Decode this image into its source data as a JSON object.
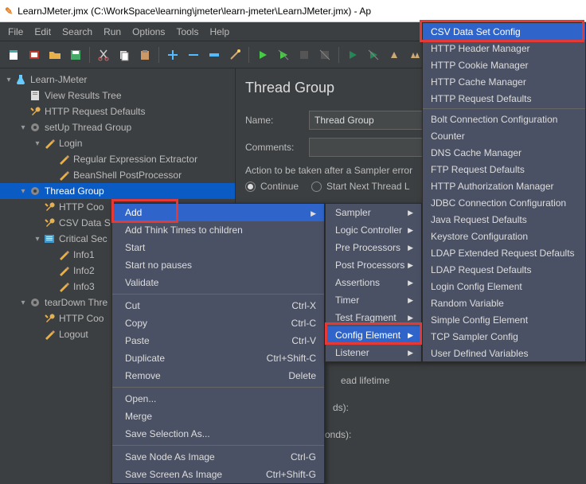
{
  "title": "LearnJMeter.jmx (C:\\WorkSpace\\learning\\jmeter\\learn-jmeter\\LearnJMeter.jmx) - Ap",
  "menubar": [
    "File",
    "Edit",
    "Search",
    "Run",
    "Options",
    "Tools",
    "Help"
  ],
  "tree": [
    {
      "indent": 0,
      "tw": "▾",
      "icon": "beaker",
      "label": "Learn-JMeter"
    },
    {
      "indent": 1,
      "tw": "",
      "icon": "doc",
      "label": "View Results Tree"
    },
    {
      "indent": 1,
      "tw": "",
      "icon": "wrench",
      "label": "HTTP Request Defaults"
    },
    {
      "indent": 1,
      "tw": "▾",
      "icon": "gear",
      "label": "setUp Thread Group"
    },
    {
      "indent": 2,
      "tw": "▾",
      "icon": "pen",
      "label": "Login"
    },
    {
      "indent": 3,
      "tw": "",
      "icon": "pen",
      "label": "Regular Expression Extractor"
    },
    {
      "indent": 3,
      "tw": "",
      "icon": "pen",
      "label": "BeanShell PostProcessor"
    },
    {
      "indent": 1,
      "tw": "▾",
      "icon": "gear",
      "label": "Thread Group",
      "sel": true
    },
    {
      "indent": 2,
      "tw": "",
      "icon": "wrench",
      "label": "HTTP Coo"
    },
    {
      "indent": 2,
      "tw": "",
      "icon": "wrench",
      "label": "CSV Data S"
    },
    {
      "indent": 2,
      "tw": "▾",
      "icon": "list",
      "label": "Critical Sec"
    },
    {
      "indent": 3,
      "tw": "",
      "icon": "pen",
      "label": "Info1"
    },
    {
      "indent": 3,
      "tw": "",
      "icon": "pen",
      "label": "Info2"
    },
    {
      "indent": 3,
      "tw": "",
      "icon": "pen",
      "label": "Info3"
    },
    {
      "indent": 1,
      "tw": "▾",
      "icon": "gear",
      "label": "tearDown Thre"
    },
    {
      "indent": 2,
      "tw": "",
      "icon": "wrench",
      "label": "HTTP Coo"
    },
    {
      "indent": 2,
      "tw": "",
      "icon": "pen",
      "label": "Logout"
    }
  ],
  "main": {
    "heading": "Thread Group",
    "name_label": "Name:",
    "name_value": "Thread Group",
    "comments_label": "Comments:",
    "comments_value": "",
    "action_label": "Action to be taken after a Sampler error",
    "continue": "Continue",
    "startnext": "Start Next Thread L",
    "leftover1": "ead lifetime",
    "leftover2": "ds):",
    "leftover3": "conds):"
  },
  "ctx": {
    "items": [
      {
        "label": "Add",
        "sub": true,
        "sel": true
      },
      {
        "label": "Add Think Times to children"
      },
      {
        "label": "Start"
      },
      {
        "label": "Start no pauses"
      },
      {
        "label": "Validate"
      },
      {
        "div": true
      },
      {
        "label": "Cut",
        "sc": "Ctrl-X"
      },
      {
        "label": "Copy",
        "sc": "Ctrl-C"
      },
      {
        "label": "Paste",
        "sc": "Ctrl-V"
      },
      {
        "label": "Duplicate",
        "sc": "Ctrl+Shift-C"
      },
      {
        "label": "Remove",
        "sc": "Delete"
      },
      {
        "div": true
      },
      {
        "label": "Open..."
      },
      {
        "label": "Merge"
      },
      {
        "label": "Save Selection As..."
      },
      {
        "div": true
      },
      {
        "label": "Save Node As Image",
        "sc": "Ctrl-G"
      },
      {
        "label": "Save Screen As Image",
        "sc": "Ctrl+Shift-G"
      }
    ]
  },
  "submenu": {
    "items": [
      {
        "label": "Sampler"
      },
      {
        "label": "Logic Controller"
      },
      {
        "label": "Pre Processors"
      },
      {
        "label": "Post Processors"
      },
      {
        "label": "Assertions"
      },
      {
        "label": "Timer"
      },
      {
        "label": "Test Fragment"
      },
      {
        "label": "Config Element",
        "sel": true
      },
      {
        "label": "Listener"
      }
    ]
  },
  "cfgmenu": {
    "items": [
      {
        "label": "CSV Data Set Config",
        "sel": true
      },
      {
        "label": "HTTP Header Manager"
      },
      {
        "label": "HTTP Cookie Manager"
      },
      {
        "label": "HTTP Cache Manager"
      },
      {
        "label": "HTTP Request Defaults"
      },
      {
        "div": true
      },
      {
        "label": "Bolt Connection Configuration"
      },
      {
        "label": "Counter"
      },
      {
        "label": "DNS Cache Manager"
      },
      {
        "label": "FTP Request Defaults"
      },
      {
        "label": "HTTP Authorization Manager"
      },
      {
        "label": "JDBC Connection Configuration"
      },
      {
        "label": "Java Request Defaults"
      },
      {
        "label": "Keystore Configuration"
      },
      {
        "label": "LDAP Extended Request Defaults"
      },
      {
        "label": "LDAP Request Defaults"
      },
      {
        "label": "Login Config Element"
      },
      {
        "label": "Random Variable"
      },
      {
        "label": "Simple Config Element"
      },
      {
        "label": "TCP Sampler Config"
      },
      {
        "label": "User Defined Variables"
      }
    ]
  }
}
